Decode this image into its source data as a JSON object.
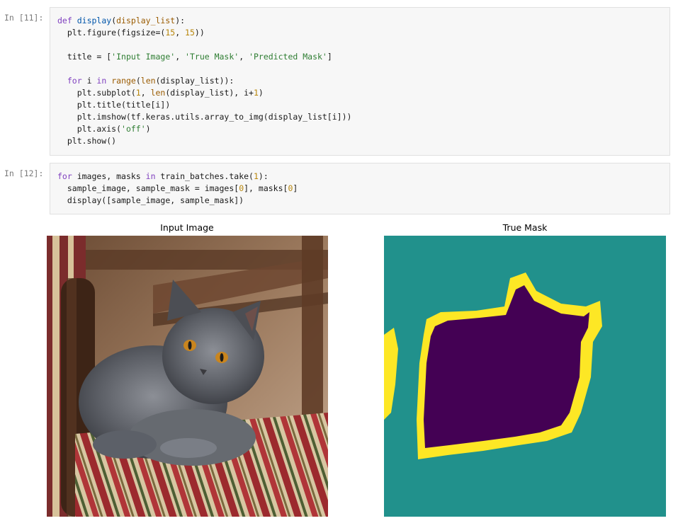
{
  "cells": [
    {
      "prompt": "In [11]:",
      "lines": [
        [
          [
            "kw2",
            "def"
          ],
          [
            "nm",
            " "
          ],
          [
            "fn",
            "display"
          ],
          [
            "nm",
            "("
          ],
          [
            "bi",
            "display_list"
          ],
          [
            "nm",
            "):"
          ]
        ],
        [
          [
            "nm",
            "  plt.figure(figsize=("
          ],
          [
            "num",
            "15"
          ],
          [
            "nm",
            ", "
          ],
          [
            "num",
            "15"
          ],
          [
            "nm",
            "))"
          ]
        ],
        [
          [
            "nm",
            ""
          ]
        ],
        [
          [
            "nm",
            "  title = ["
          ],
          [
            "strg",
            "'Input Image'"
          ],
          [
            "nm",
            ", "
          ],
          [
            "strg",
            "'True Mask'"
          ],
          [
            "nm",
            ", "
          ],
          [
            "strg",
            "'Predicted Mask'"
          ],
          [
            "nm",
            "]"
          ]
        ],
        [
          [
            "nm",
            ""
          ]
        ],
        [
          [
            "nm",
            "  "
          ],
          [
            "kw2",
            "for"
          ],
          [
            "nm",
            " i "
          ],
          [
            "kw2",
            "in"
          ],
          [
            "nm",
            " "
          ],
          [
            "bi",
            "range"
          ],
          [
            "nm",
            "("
          ],
          [
            "bi",
            "len"
          ],
          [
            "nm",
            "(display_list)):"
          ]
        ],
        [
          [
            "nm",
            "    plt.subplot("
          ],
          [
            "num",
            "1"
          ],
          [
            "nm",
            ", "
          ],
          [
            "bi",
            "len"
          ],
          [
            "nm",
            "(display_list), i+"
          ],
          [
            "num",
            "1"
          ],
          [
            "nm",
            ")"
          ]
        ],
        [
          [
            "nm",
            "    plt.title(title[i])"
          ]
        ],
        [
          [
            "nm",
            "    plt.imshow(tf.keras.utils.array_to_img(display_list[i]))"
          ]
        ],
        [
          [
            "nm",
            "    plt.axis("
          ],
          [
            "strg",
            "'off'"
          ],
          [
            "nm",
            ")"
          ]
        ],
        [
          [
            "nm",
            "  plt.show()"
          ]
        ]
      ]
    },
    {
      "prompt": "In [12]:",
      "lines": [
        [
          [
            "kw2",
            "for"
          ],
          [
            "nm",
            " images, masks "
          ],
          [
            "kw2",
            "in"
          ],
          [
            "nm",
            " train_batches.take("
          ],
          [
            "num",
            "1"
          ],
          [
            "nm",
            "):"
          ]
        ],
        [
          [
            "nm",
            "  sample_image, sample_mask = images["
          ],
          [
            "num",
            "0"
          ],
          [
            "nm",
            "], masks["
          ],
          [
            "num",
            "0"
          ],
          [
            "nm",
            "]"
          ]
        ],
        [
          [
            "nm",
            "  display([sample_image, sample_mask])"
          ]
        ]
      ]
    }
  ],
  "output": {
    "titles": [
      "Input Image",
      "True Mask"
    ]
  },
  "colors": {
    "mask_background": "#21918c",
    "mask_object": "#440154",
    "mask_border": "#fde725"
  }
}
